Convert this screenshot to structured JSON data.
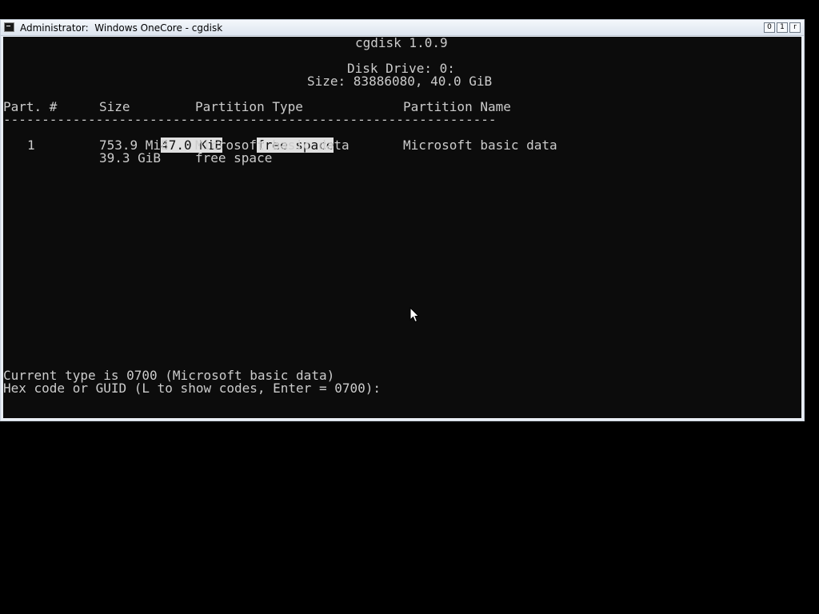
{
  "window": {
    "title": "Administrator:  Windows OneCore - cgdisk",
    "controls": {
      "minimize": "0",
      "maximize": "1",
      "close": "r"
    }
  },
  "console": {
    "app_title": "cgdisk 1.0.9",
    "disk_drive": "Disk Drive: 0:",
    "size_info": "Size: 83886080, 40.0 GiB",
    "headers": {
      "part": "Part. #",
      "size": "Size",
      "type": "Partition Type",
      "name": "Partition Name"
    },
    "separator": "----------------------------------------------------------------",
    "partitions": [
      {
        "part": "",
        "size": "47.0 KiB",
        "type": "free space",
        "name": "",
        "selected": true
      },
      {
        "part": "1",
        "size": "753.9 MiB",
        "type": "Microsoft basic data",
        "name": "Microsoft basic data",
        "selected": false
      },
      {
        "part": "",
        "size": "39.3 GiB",
        "type": "free space",
        "name": "",
        "selected": false
      }
    ],
    "current_type": "Current type is 0700 (Microsoft basic data)",
    "prompt": "Hex code or GUID (L to show codes, Enter = 0700):"
  }
}
